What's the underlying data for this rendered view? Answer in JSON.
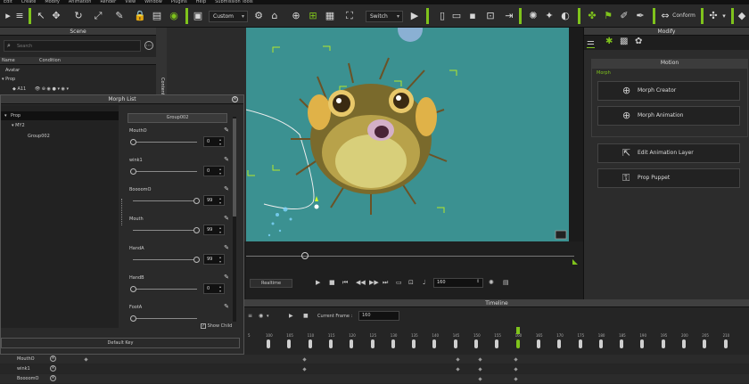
{
  "menubar": {
    "items": [
      "Edit",
      "Create",
      "Modify",
      "Animation",
      "Render",
      "View",
      "Window",
      "Plugins",
      "Help",
      "Submission Tools"
    ]
  },
  "toolbar": {
    "view_mode": "Custom",
    "switch_label": "Switch",
    "conform_label": "Conform",
    "accent": "#7fc31c"
  },
  "scene": {
    "title": "Scene",
    "search_placeholder": "Search",
    "col_name": "Name",
    "col_condition": "Condition",
    "items": [
      "Avatar",
      "Prop",
      "A11"
    ]
  },
  "morph_list": {
    "title": "Morph List",
    "tree": [
      "Prop",
      "MY2",
      "Group002"
    ],
    "group_header": "Group002",
    "sliders": [
      {
        "label": "MouthO",
        "value": "0",
        "fraction": 0.0
      },
      {
        "label": "wink1",
        "value": "0",
        "fraction": 0.0
      },
      {
        "label": "BoooomO",
        "value": "99",
        "fraction": 0.99
      },
      {
        "label": "Mouth",
        "value": "99",
        "fraction": 0.99
      },
      {
        "label": "HandA",
        "value": "99",
        "fraction": 0.99
      },
      {
        "label": "HandB",
        "value": "0",
        "fraction": 0.0
      },
      {
        "label": "FootA",
        "value": "",
        "fraction": 0.0
      }
    ],
    "show_child": "Show Child",
    "default_key": "Default Key"
  },
  "playback": {
    "mode_label": "Realtime",
    "frame_value": "160"
  },
  "modify": {
    "title": "Modify",
    "section_title": "Motion",
    "group_label": "Morph",
    "buttons": [
      "Morph Creator",
      "Morph Animation",
      "Edit Animation Layer",
      "Prop Puppet"
    ]
  },
  "timeline": {
    "title": "Timeline",
    "current_frame_label": "Current Frame :",
    "current_frame_value": "160",
    "ruler": [
      "5",
      "100",
      "105",
      "110",
      "115",
      "120",
      "125",
      "130",
      "135",
      "140",
      "145",
      "150",
      "155",
      "160",
      "165",
      "170",
      "175",
      "180",
      "185",
      "190",
      "195",
      "200",
      "205",
      "210"
    ],
    "tracks": [
      "MouthO",
      "wink1",
      "BoooomO"
    ]
  }
}
